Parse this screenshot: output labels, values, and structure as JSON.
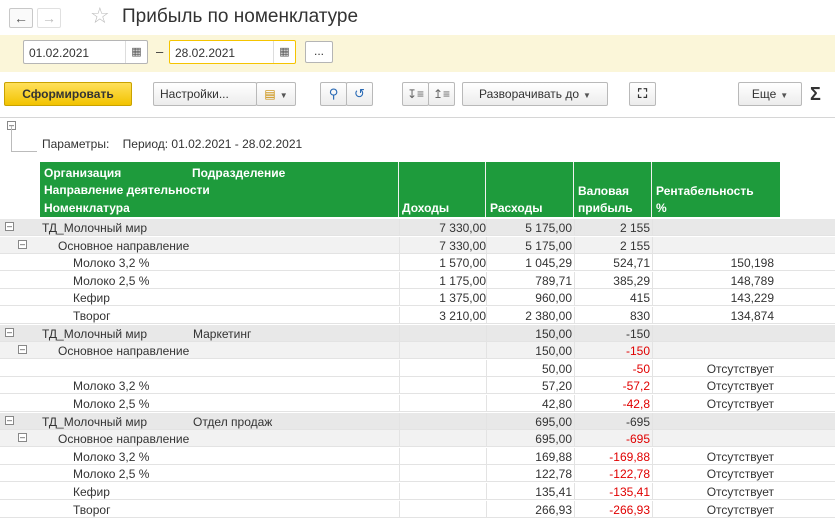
{
  "title": "Прибыль по номенклатуре",
  "period": {
    "from": "01.02.2021",
    "to": "28.02.2021",
    "dash": "–",
    "more": "..."
  },
  "toolbar": {
    "generate": "Сформировать",
    "settings": "Настройки...",
    "expand_to": "Разворачивать до",
    "more": "Еще",
    "sigma": "Σ"
  },
  "params": {
    "label": "Параметры:",
    "value": "Период: 01.02.2021 - 28.02.2021"
  },
  "headers": {
    "org": "Организация",
    "subdiv": "Подразделение",
    "direction": "Направление деятельности",
    "nomenclature": "Номенклатура",
    "income": "Доходы",
    "expenses": "Расходы",
    "gross1": "Валовая",
    "gross2": "прибыль",
    "rent1": "Рентабельность",
    "rent2": "%"
  },
  "rows": [
    {
      "level": 0,
      "name": "ТД_Молочный мир",
      "sub": "",
      "income": "7 330,00",
      "expenses": "5 175,00",
      "gross": "2 155",
      "rent": "",
      "neg": false
    },
    {
      "level": 1,
      "name": "Основное направление",
      "sub": "",
      "income": "7 330,00",
      "expenses": "5 175,00",
      "gross": "2 155",
      "rent": "",
      "neg": false
    },
    {
      "level": 2,
      "name": "Молоко 3,2 %",
      "sub": "",
      "income": "1 570,00",
      "expenses": "1 045,29",
      "gross": "524,71",
      "rent": "150,198",
      "neg": false
    },
    {
      "level": 2,
      "name": "Молоко 2,5 %",
      "sub": "",
      "income": "1 175,00",
      "expenses": "789,71",
      "gross": "385,29",
      "rent": "148,789",
      "neg": false
    },
    {
      "level": 2,
      "name": "Кефир",
      "sub": "",
      "income": "1 375,00",
      "expenses": "960,00",
      "gross": "415",
      "rent": "143,229",
      "neg": false
    },
    {
      "level": 2,
      "name": "Творог",
      "sub": "",
      "income": "3 210,00",
      "expenses": "2 380,00",
      "gross": "830",
      "rent": "134,874",
      "neg": false
    },
    {
      "level": 0,
      "name": "ТД_Молочный мир",
      "sub": "Маркетинг",
      "income": "",
      "expenses": "150,00",
      "gross": "-150",
      "rent": "",
      "neg": false
    },
    {
      "level": 1,
      "name": "Основное направление",
      "sub": "",
      "income": "",
      "expenses": "150,00",
      "gross": "-150",
      "rent": "",
      "neg": true
    },
    {
      "level": 2,
      "name": "",
      "sub": "",
      "income": "",
      "expenses": "50,00",
      "gross": "-50",
      "rent": "Отсутствует",
      "neg": true
    },
    {
      "level": 2,
      "name": "Молоко 3,2 %",
      "sub": "",
      "income": "",
      "expenses": "57,20",
      "gross": "-57,2",
      "rent": "Отсутствует",
      "neg": true
    },
    {
      "level": 2,
      "name": "Молоко 2,5 %",
      "sub": "",
      "income": "",
      "expenses": "42,80",
      "gross": "-42,8",
      "rent": "Отсутствует",
      "neg": true
    },
    {
      "level": 0,
      "name": "ТД_Молочный мир",
      "sub": "Отдел продаж",
      "income": "",
      "expenses": "695,00",
      "gross": "-695",
      "rent": "",
      "neg": false
    },
    {
      "level": 1,
      "name": "Основное направление",
      "sub": "",
      "income": "",
      "expenses": "695,00",
      "gross": "-695",
      "rent": "",
      "neg": true
    },
    {
      "level": 2,
      "name": "Молоко 3,2 %",
      "sub": "",
      "income": "",
      "expenses": "169,88",
      "gross": "-169,88",
      "rent": "Отсутствует",
      "neg": true
    },
    {
      "level": 2,
      "name": "Молоко 2,5 %",
      "sub": "",
      "income": "",
      "expenses": "122,78",
      "gross": "-122,78",
      "rent": "Отсутствует",
      "neg": true
    },
    {
      "level": 2,
      "name": "Кефир",
      "sub": "",
      "income": "",
      "expenses": "135,41",
      "gross": "-135,41",
      "rent": "Отсутствует",
      "neg": true
    },
    {
      "level": 2,
      "name": "Творог",
      "sub": "",
      "income": "",
      "expenses": "266,93",
      "gross": "-266,93",
      "rent": "Отсутствует",
      "neg": true
    }
  ],
  "colors": {
    "header_bg": "#1e9b3c",
    "negative": "#e00000",
    "period_bg": "#fbf6d9",
    "primary_btn": "#f5c400"
  }
}
